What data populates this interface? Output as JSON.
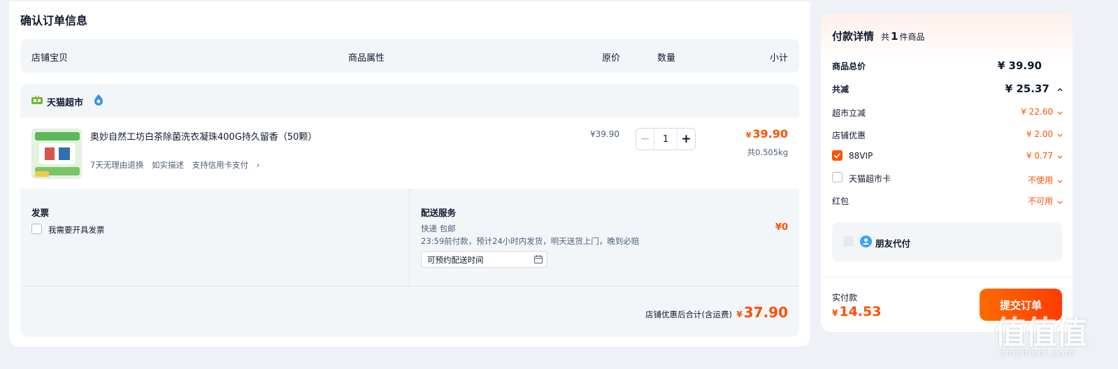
{
  "page": {
    "title": "确认订单信息"
  },
  "columns": [
    "店铺宝贝",
    "商品属性",
    "原价",
    "数量",
    "小计"
  ],
  "shop": {
    "name": "天猫超市",
    "item": {
      "title": "奥妙自然工坊白茶除菌洗衣凝珠400G持久留香（50颗）",
      "tags": [
        "7天无理由退换",
        "如实描述",
        "支持信用卡支付"
      ],
      "tags_more": "›",
      "original_price": "¥39.90",
      "quantity": "1",
      "minus": "−",
      "plus": "+",
      "subtotal_currency": "¥",
      "subtotal": "39.90",
      "weight": "共0.505kg"
    },
    "invoice": {
      "title": "发票",
      "checkbox_label": "我需要开具发票"
    },
    "delivery": {
      "title": "配送服务",
      "method": "快递 包邮",
      "desc": "23:59前付款，预计24小时内发货，明天送货上门，晚到必赔",
      "schedule_placeholder": "可预约配送时间",
      "fee": "¥0"
    },
    "total_label": "店铺优惠后合计(含运费)",
    "total_currency": "¥",
    "total": "37.90"
  },
  "payment": {
    "title": "付款详情",
    "count_prefix": "共",
    "count": "1",
    "count_suffix": "件商品",
    "rows": [
      {
        "label": "商品总价",
        "value": "¥ 39.90"
      },
      {
        "label": "共减",
        "value": "¥ 25.37"
      },
      {
        "label": "超市立减",
        "value": "¥ 22.60"
      },
      {
        "label": "店铺优惠",
        "value": "¥ 2.00"
      },
      {
        "label": "88VIP",
        "value": "¥ 0.77"
      },
      {
        "label": "天猫超市卡",
        "value": "不使用"
      },
      {
        "label": "红包",
        "value": "不可用"
      }
    ],
    "friend_pay": "朋友代付",
    "paid_label": "实付款",
    "paid_currency": "¥",
    "paid": "14.53",
    "submit": "提交订单"
  },
  "watermark": {
    "logo": "值值值",
    "text": "zhizhizhi.com"
  },
  "colors": {
    "accent": "#ff5000",
    "bg": "#eef1f5",
    "panel": "#f3f6f9"
  }
}
